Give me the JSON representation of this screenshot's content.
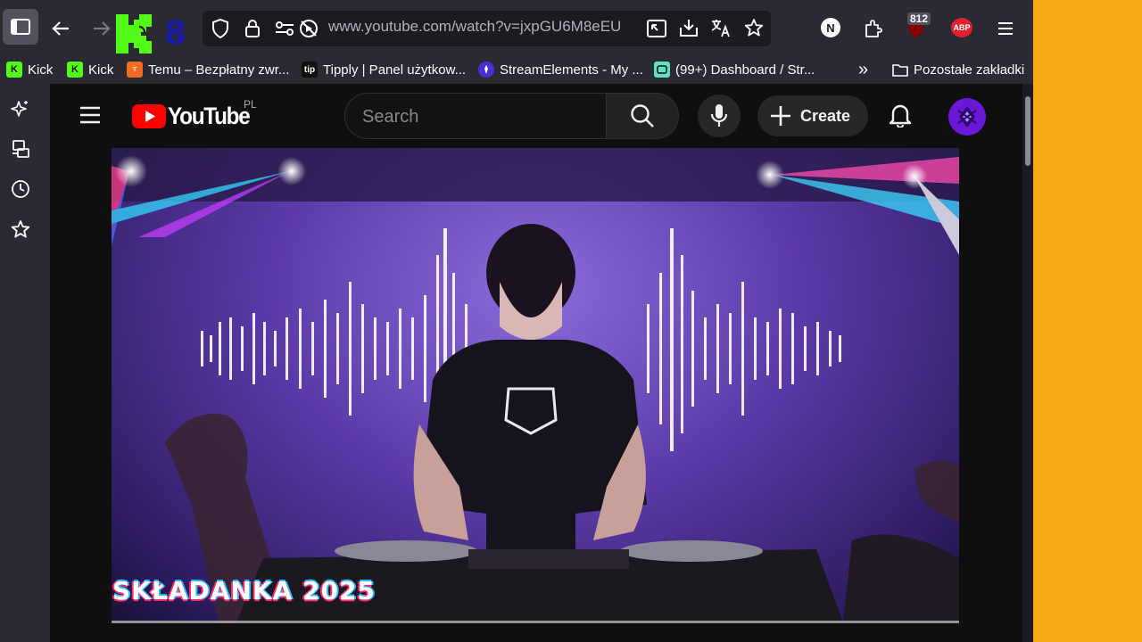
{
  "browser": {
    "url": "www.youtube.com/watch?v=jxpGU6M8eEU",
    "extensions": {
      "notification_badge": "812",
      "abp_label": "ABP",
      "n_label": "N"
    },
    "bookmarks": [
      {
        "label": "Kick",
        "favicon": "kick"
      },
      {
        "label": "Kick",
        "favicon": "kick"
      },
      {
        "label": "Temu – Bezpłatny zwr...",
        "favicon": "temu"
      },
      {
        "label": "Tipply | Panel użytkow...",
        "favicon": "tipply",
        "favicon_text": "tip"
      },
      {
        "label": "StreamElements - My ...",
        "favicon": "streamelements"
      },
      {
        "label": "(99+) Dashboard / Str...",
        "favicon": "dashboard"
      }
    ],
    "overflow_label": "»",
    "other_bookmarks": "Pozostałe zakładki",
    "overlay_number": "8"
  },
  "youtube": {
    "logo_text": "YouTube",
    "region": "PL",
    "search_placeholder": "Search",
    "create_label": "Create"
  },
  "video": {
    "caption": "SKŁADANKA 2025"
  },
  "colors": {
    "accent_yellow": "#f4aa14",
    "youtube_red": "#ff0000",
    "avatar_purple": "#6a17d8"
  }
}
